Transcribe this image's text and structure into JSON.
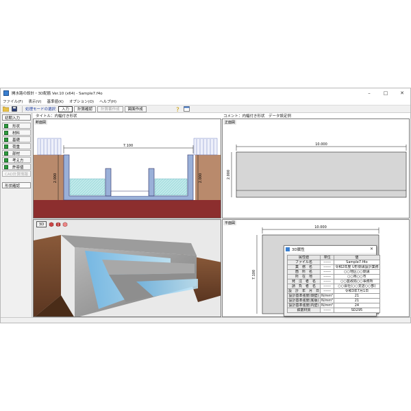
{
  "window": {
    "title": "開水路の設計・3D配筋 Ver.10 (x64) - Sample7.f4o",
    "controls": [
      "–",
      "□",
      "✕"
    ]
  },
  "menu": {
    "items": [
      "ファイル(F)",
      "表示(V)",
      "基準値(K)",
      "オプション(O)",
      "ヘルプ(H)"
    ]
  },
  "toolbar": {
    "mode_label": "処理モードの選択",
    "buttons": [
      "入力",
      "計算確認",
      "計算書作成",
      "図面作成"
    ]
  },
  "sidebar": {
    "head": "初期入力",
    "items": [
      "形状",
      "材料",
      "基礎",
      "荷重",
      "部材",
      "考え方",
      "許容値"
    ],
    "disabled_item": "CAD計算情報",
    "bottom": "形状確認"
  },
  "info": {
    "title": "タイトル：内幅付き形状",
    "comment": "コメント：内幅付き形状　データ設定例"
  },
  "panes": {
    "section_label": "断面図",
    "front_label": "正面図",
    "plan_label": "平面図",
    "view3d_label": "3D"
  },
  "dims": {
    "section_width": "7.100",
    "section_left_h": "2.000",
    "section_right_h": "2.000",
    "front_width": "10.000",
    "front_height": "2.000",
    "plan_width": "10.000",
    "plan_height": "7.100"
  },
  "dialog": {
    "title": "3D属性",
    "headers": [
      "属性値",
      "単位",
      "値"
    ],
    "rows": [
      [
        "ファイル名",
        "------",
        "Sample7.f4o"
      ],
      [
        "業　務　名",
        "------",
        "令和2年度 U形側溝設計業務"
      ],
      [
        "箇　所　名",
        "------",
        "○○地区○○側溝"
      ],
      [
        "所　在　地",
        "------",
        "○○県○○市"
      ],
      [
        "発　注　者　名",
        "------",
        "○○農政局○○事務所"
      ],
      [
        "請　負　者　名",
        "------",
        "○○会社(○○支店○○部)"
      ],
      [
        "設　計　年　月　日",
        "------",
        "令和3年7月1日"
      ],
      [
        "設計基準強度(側壁)",
        "N/mm²",
        "21"
      ],
      [
        "設計基準強度(底版)",
        "N/mm²",
        "21"
      ],
      [
        "設計基準強度(内壁)",
        "N/mm²",
        "24"
      ],
      [
        "鉄筋材質",
        "------",
        "SD295"
      ]
    ]
  },
  "colors": {
    "concrete_section": "#9ab0d8",
    "soil": "#b98a6c",
    "base": "#8c2e2e",
    "water": "#bfe9ea",
    "front_fill": "#d6d6d6",
    "accent": "#1a3aa0"
  }
}
